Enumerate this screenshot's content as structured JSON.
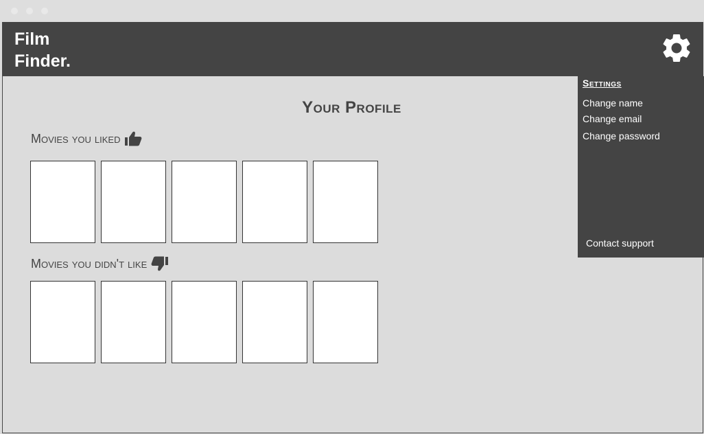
{
  "app": {
    "brand_line1": "Film",
    "brand_line2": "Finder."
  },
  "header": {
    "settings_icon": "gear-icon"
  },
  "settings": {
    "title": "Settings",
    "links": [
      "Change name",
      "Change email",
      "Change password"
    ],
    "contact": "Contact support"
  },
  "profile": {
    "title": "Your Profile",
    "liked_label": "Movies you liked",
    "liked_icon": "thumbs-up-icon",
    "disliked_label": "Movies you didn't like",
    "disliked_icon": "thumbs-down-icon"
  },
  "colors": {
    "header_bg": "#444444",
    "page_bg": "#dcdcdc",
    "card_bg": "#ffffff"
  }
}
